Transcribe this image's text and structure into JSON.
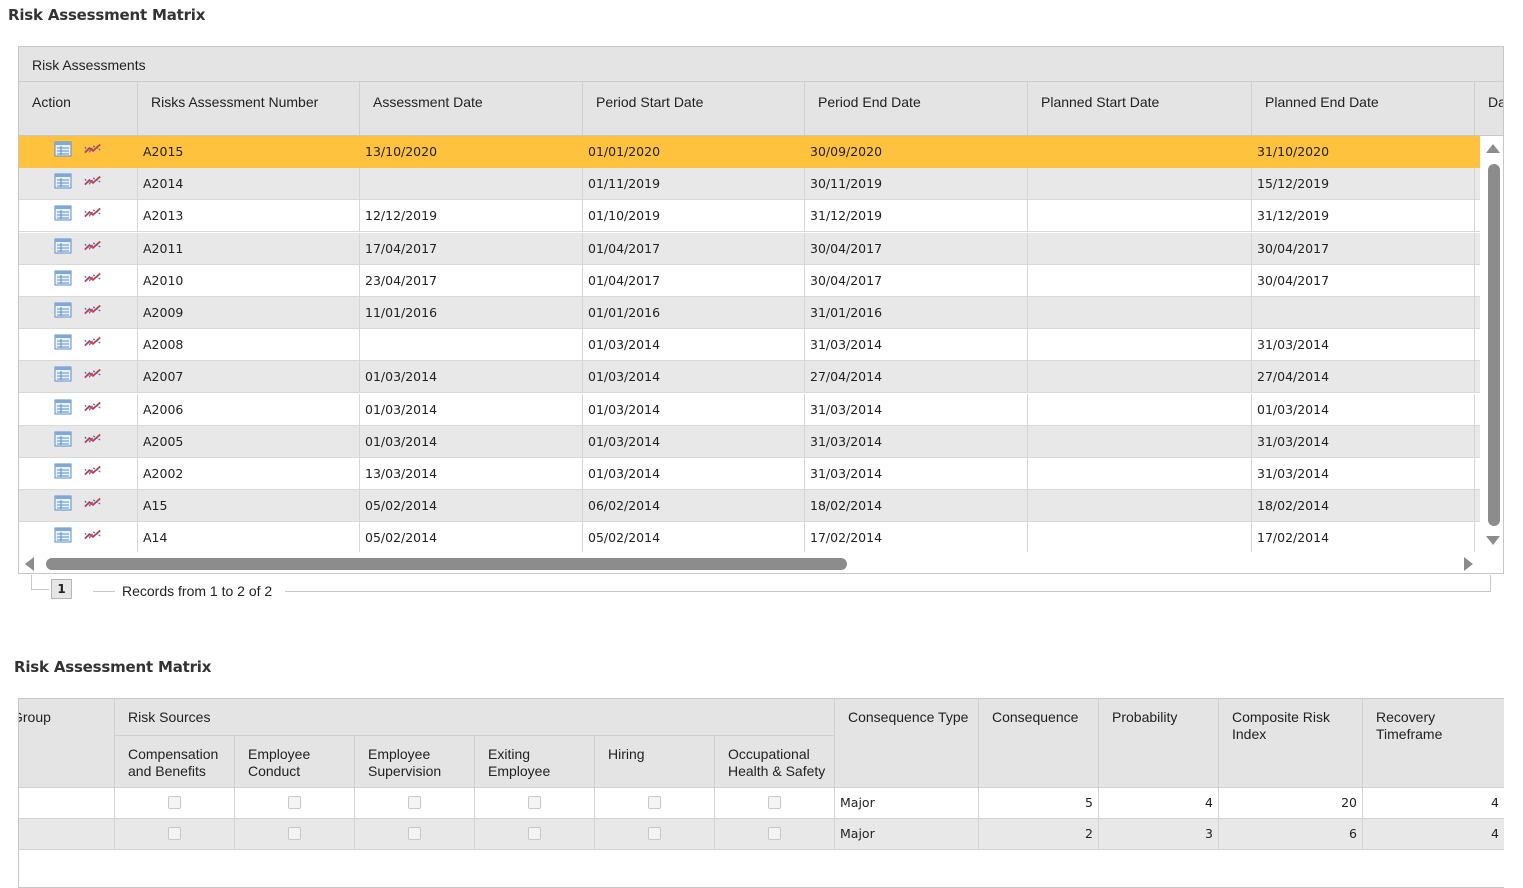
{
  "page": {
    "title": "Risk Assessment Matrix",
    "matrix_title": "Risk Assessment Matrix"
  },
  "grid": {
    "caption": "Risk Assessments",
    "columns": [
      "Action",
      "Risks Assessment Number",
      "Assessment Date",
      "Period Start Date",
      "Period End Date",
      "Planned Start Date",
      "Planned End Date",
      "Da"
    ],
    "action_icons": [
      "table-view-icon",
      "chart-trend-icon"
    ],
    "rows": [
      {
        "number": "A2015",
        "assessment_date": "13/10/2020",
        "period_start": "01/01/2020",
        "period_end": "30/09/2020",
        "planned_start": "",
        "planned_end": "31/10/2020",
        "selected": true
      },
      {
        "number": "A2014",
        "assessment_date": "",
        "period_start": "01/11/2019",
        "period_end": "30/11/2019",
        "planned_start": "",
        "planned_end": "15/12/2019"
      },
      {
        "number": "A2013",
        "assessment_date": "12/12/2019",
        "period_start": "01/10/2019",
        "period_end": "31/12/2019",
        "planned_start": "",
        "planned_end": "31/12/2019"
      },
      {
        "number": "A2011",
        "assessment_date": "17/04/2017",
        "period_start": "01/04/2017",
        "period_end": "30/04/2017",
        "planned_start": "",
        "planned_end": "30/04/2017"
      },
      {
        "number": "A2010",
        "assessment_date": "23/04/2017",
        "period_start": "01/04/2017",
        "period_end": "30/04/2017",
        "planned_start": "",
        "planned_end": "30/04/2017"
      },
      {
        "number": "A2009",
        "assessment_date": "11/01/2016",
        "period_start": "01/01/2016",
        "period_end": "31/01/2016",
        "planned_start": "",
        "planned_end": ""
      },
      {
        "number": "A2008",
        "assessment_date": "",
        "period_start": "01/03/2014",
        "period_end": "31/03/2014",
        "planned_start": "",
        "planned_end": "31/03/2014"
      },
      {
        "number": "A2007",
        "assessment_date": "01/03/2014",
        "period_start": "01/03/2014",
        "period_end": "27/04/2014",
        "planned_start": "",
        "planned_end": "27/04/2014"
      },
      {
        "number": "A2006",
        "assessment_date": "01/03/2014",
        "period_start": "01/03/2014",
        "period_end": "31/03/2014",
        "planned_start": "",
        "planned_end": "01/03/2014"
      },
      {
        "number": "A2005",
        "assessment_date": "01/03/2014",
        "period_start": "01/03/2014",
        "period_end": "31/03/2014",
        "planned_start": "",
        "planned_end": "31/03/2014"
      },
      {
        "number": "A2002",
        "assessment_date": "13/03/2014",
        "period_start": "01/03/2014",
        "period_end": "31/03/2014",
        "planned_start": "",
        "planned_end": "31/03/2014"
      },
      {
        "number": "A15",
        "assessment_date": "05/02/2014",
        "period_start": "06/02/2014",
        "period_end": "18/02/2014",
        "planned_start": "",
        "planned_end": "18/02/2014"
      },
      {
        "number": "A14",
        "assessment_date": "05/02/2014",
        "period_start": "05/02/2014",
        "period_end": "17/02/2014",
        "planned_start": "",
        "planned_end": "17/02/2014"
      }
    ]
  },
  "pager": {
    "current_page": "1",
    "records_text": "Records from 1 to 2 of 2"
  },
  "matrix": {
    "group_header": "Group",
    "risk_sources_header": "Risk Sources",
    "risk_sources": [
      "Compensation and Benefits",
      "Employee Conduct",
      "Employee Supervision",
      "Exiting Employee",
      "Hiring",
      "Occupational Health & Safety"
    ],
    "columns": [
      "Consequence Type",
      "Consequence",
      "Probability",
      "Composite Risk Index",
      "Recovery Timeframe"
    ],
    "rows": [
      {
        "group": "",
        "checks": [
          false,
          false,
          false,
          false,
          false,
          false
        ],
        "consequence_type": "Major",
        "consequence": "5",
        "probability": "4",
        "composite_risk_index": "20",
        "recovery_timeframe": "4"
      },
      {
        "group": "",
        "checks": [
          false,
          false,
          false,
          false,
          false,
          false
        ],
        "consequence_type": "Major",
        "consequence": "2",
        "probability": "3",
        "composite_risk_index": "6",
        "recovery_timeframe": "4"
      }
    ]
  },
  "colors": {
    "selected_row": "#fec23e",
    "header_bg": "#e4e4e4",
    "alt_row": "#e8e8e8"
  }
}
